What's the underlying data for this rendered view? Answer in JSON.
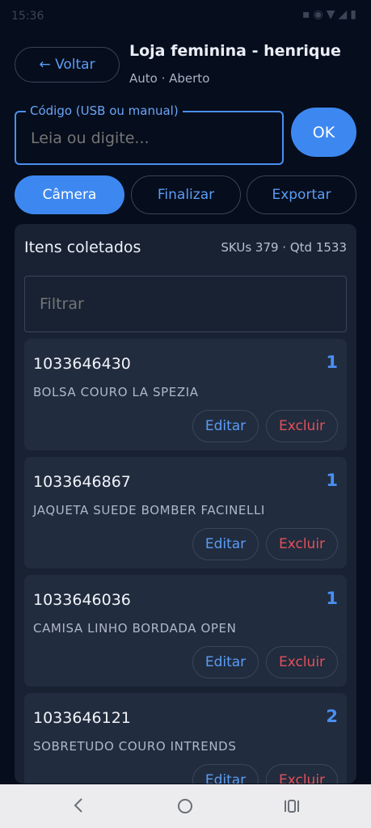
{
  "status_bar": {
    "time": "15:36",
    "icons": [
      "gallery-icon",
      "location-icon",
      "wifi-icon",
      "signal-icon",
      "battery-icon"
    ]
  },
  "header": {
    "back_label": "← Voltar",
    "title": "Loja feminina - henrique",
    "subtitle": "Auto · Aberto"
  },
  "scanner": {
    "legend": "Código (USB ou manual)",
    "placeholder": "Leia ou digite...",
    "ok_label": "OK"
  },
  "actions": {
    "camera": "Câmera",
    "finalizar": "Finalizar",
    "exportar": "Exportar"
  },
  "panel": {
    "title": "Itens coletados",
    "stats": "SKUs 379 · Qtd 1533",
    "filter_placeholder": "Filtrar"
  },
  "items": [
    {
      "code": "1033646430",
      "qty": "1",
      "desc": "BOLSA COURO LA SPEZIA",
      "edit": "Editar",
      "delete": "Excluir"
    },
    {
      "code": "1033646867",
      "qty": "1",
      "desc": "JAQUETA SUEDE BOMBER FACINELLI",
      "edit": "Editar",
      "delete": "Excluir"
    },
    {
      "code": "1033646036",
      "qty": "1",
      "desc": "CAMISA LINHO BORDADA OPEN",
      "edit": "Editar",
      "delete": "Excluir"
    },
    {
      "code": "1033646121",
      "qty": "2",
      "desc": "SOBRETUDO COURO INTRENDS",
      "edit": "Editar",
      "delete": "Excluir"
    }
  ],
  "colors": {
    "background": "#060d1c",
    "accent": "#3d88f0",
    "danger": "#e2515a",
    "panel": "#182233",
    "card": "#212c3e"
  }
}
